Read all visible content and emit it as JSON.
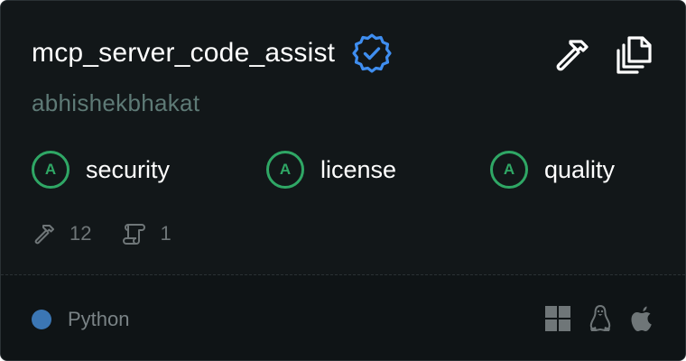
{
  "server": {
    "name": "mcp_server_code_assist",
    "author": "abhishekbhakat",
    "verified": true
  },
  "actions": [
    {
      "name": "tools-hammer-icon",
      "label": ""
    },
    {
      "name": "copy-icon",
      "label": ""
    }
  ],
  "grades": [
    {
      "grade": "A",
      "label": "security"
    },
    {
      "grade": "A",
      "label": "license"
    },
    {
      "grade": "A",
      "label": "quality"
    }
  ],
  "stats": {
    "tools_count": "12",
    "prompts_count": "1"
  },
  "language": {
    "name": "Python",
    "color": "#3b76b4"
  },
  "platforms": [
    "windows-icon",
    "linux-icon",
    "apple-icon"
  ],
  "colors": {
    "background": "#121719",
    "accent_green": "#2fa765",
    "verified_blue": "#3f8ef0",
    "muted_text": "#6f7678"
  }
}
